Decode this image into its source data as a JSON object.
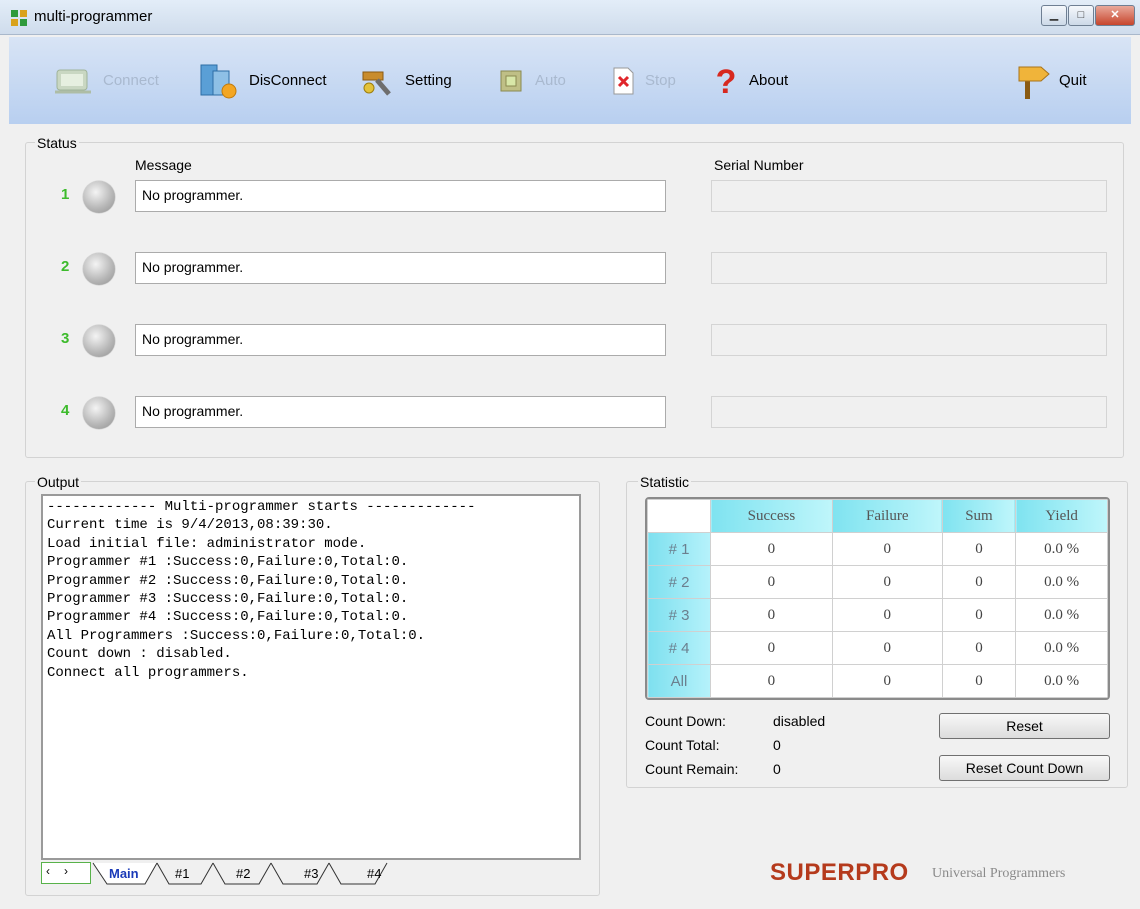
{
  "window": {
    "title": "multi-programmer"
  },
  "toolbar": {
    "connect": "Connect",
    "disconnect": "DisConnect",
    "setting": "Setting",
    "auto": "Auto",
    "stop": "Stop",
    "about": "About",
    "quit": "Quit"
  },
  "status": {
    "group_label": "Status",
    "message_header": "Message",
    "serial_header": "Serial Number",
    "rows": [
      {
        "num": "1",
        "message": "No programmer.",
        "serial": ""
      },
      {
        "num": "2",
        "message": "No programmer.",
        "serial": ""
      },
      {
        "num": "3",
        "message": "No programmer.",
        "serial": ""
      },
      {
        "num": "4",
        "message": "No programmer.",
        "serial": ""
      }
    ]
  },
  "output": {
    "group_label": "Output",
    "lines": [
      "------------- Multi-programmer starts -------------",
      "Current time is 9/4/2013,08:39:30.",
      "Load initial file: administrator mode.",
      "Programmer #1 :Success:0,Failure:0,Total:0.",
      "Programmer #2 :Success:0,Failure:0,Total:0.",
      "Programmer #3 :Success:0,Failure:0,Total:0.",
      "Programmer #4 :Success:0,Failure:0,Total:0.",
      "All Programmers :Success:0,Failure:0,Total:0.",
      "Count down : disabled.",
      "Connect all programmers."
    ],
    "tabs": [
      "Main",
      "#1",
      "#2",
      "#3",
      "#4"
    ]
  },
  "statistic": {
    "group_label": "Statistic",
    "headers": [
      "Success",
      "Failure",
      "Sum",
      "Yield"
    ],
    "rows": [
      {
        "label": "# 1",
        "values": [
          "0",
          "0",
          "0",
          "0.0 %"
        ]
      },
      {
        "label": "# 2",
        "values": [
          "0",
          "0",
          "0",
          "0.0 %"
        ]
      },
      {
        "label": "# 3",
        "values": [
          "0",
          "0",
          "0",
          "0.0 %"
        ]
      },
      {
        "label": "# 4",
        "values": [
          "0",
          "0",
          "0",
          "0.0 %"
        ]
      },
      {
        "label": "All",
        "values": [
          "0",
          "0",
          "0",
          "0.0 %"
        ]
      }
    ],
    "count_down_label": "Count Down:",
    "count_down_value": "disabled",
    "count_total_label": "Count Total:",
    "count_total_value": "0",
    "count_remain_label": "Count Remain:",
    "count_remain_value": "0",
    "reset_button": "Reset",
    "reset_count_down_button": "Reset Count Down"
  },
  "branding": {
    "logo": "SUPERPRO",
    "tagline": "Universal Programmers"
  }
}
